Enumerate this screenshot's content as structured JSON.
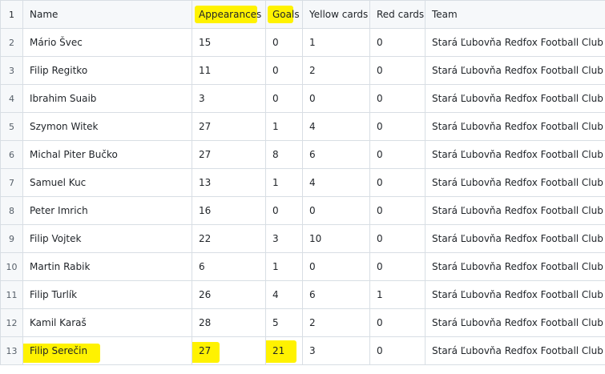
{
  "table": {
    "columns": [
      "Name",
      "Appearances",
      "Goals",
      "Yellow cards",
      "Red cards",
      "Team"
    ],
    "header_row_number": "1",
    "rows": [
      {
        "n": "2",
        "cells": [
          "Mário Švec",
          "15",
          "0",
          "1",
          "0",
          "Stará Ľubovňa Redfox Football Club"
        ]
      },
      {
        "n": "3",
        "cells": [
          "Filip Regitko",
          "11",
          "0",
          "2",
          "0",
          "Stará Ľubovňa Redfox Football Club"
        ]
      },
      {
        "n": "4",
        "cells": [
          "Ibrahim Suaib",
          "3",
          "0",
          "0",
          "0",
          "Stará Ľubovňa Redfox Football Club"
        ]
      },
      {
        "n": "5",
        "cells": [
          "Szymon Witek",
          "27",
          "1",
          "4",
          "0",
          "Stará Ľubovňa Redfox Football Club"
        ]
      },
      {
        "n": "6",
        "cells": [
          "Michal Piter Bučko",
          "27",
          "8",
          "6",
          "0",
          "Stará Ľubovňa Redfox Football Club"
        ]
      },
      {
        "n": "7",
        "cells": [
          "Samuel Kuc",
          "13",
          "1",
          "4",
          "0",
          "Stará Ľubovňa Redfox Football Club"
        ]
      },
      {
        "n": "8",
        "cells": [
          "Peter Imrich",
          "16",
          "0",
          "0",
          "0",
          "Stará Ľubovňa Redfox Football Club"
        ]
      },
      {
        "n": "9",
        "cells": [
          "Filip Vojtek",
          "22",
          "3",
          "10",
          "0",
          "Stará Ľubovňa Redfox Football Club"
        ]
      },
      {
        "n": "10",
        "cells": [
          "Martin Rabik",
          "6",
          "1",
          "0",
          "0",
          "Stará Ľubovňa Redfox Football Club"
        ]
      },
      {
        "n": "11",
        "cells": [
          "Filip Turlík",
          "26",
          "4",
          "6",
          "1",
          "Stará Ľubovňa Redfox Football Club"
        ]
      },
      {
        "n": "12",
        "cells": [
          "Kamil Karaš",
          "28",
          "5",
          "2",
          "0",
          "Stará Ľubovňa Redfox Football Club"
        ]
      },
      {
        "n": "13",
        "cells": [
          "Filip Serečin",
          "27",
          "21",
          "3",
          "0",
          "Stará Ľubovňa Redfox Football Club"
        ]
      }
    ]
  },
  "colors": {
    "highlight": "#fff200",
    "grid": "#d8dee4",
    "row_number_bg": "#f6f8fa"
  }
}
